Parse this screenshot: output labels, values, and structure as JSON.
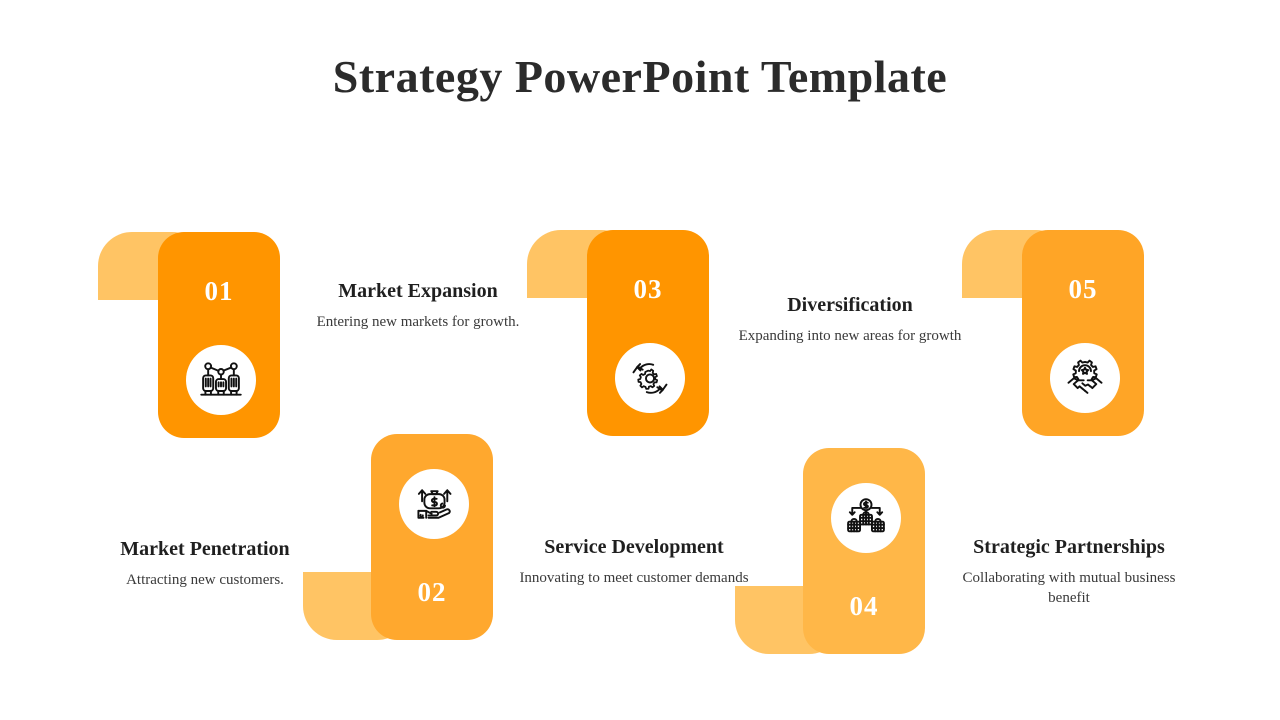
{
  "slide": {
    "title": "Strategy PowerPoint Template",
    "background_color": "#FFFFFF",
    "title_color": "#2B2B2B"
  },
  "palette": {
    "shadow_orange": "#FFC464",
    "orange_1": "#FF9500",
    "orange_2": "#FFA82E",
    "orange_3": "#FF9500",
    "orange_4": "#FFB748",
    "orange_5": "#FFA526",
    "number_color": "#FFFFFF",
    "icon_color": "#111111"
  },
  "steps": [
    {
      "number": "01",
      "title": "Market Penetration",
      "description": "Attracting new customers.",
      "icon": "market-penetration-icon",
      "orientation": "up",
      "card_color": "#FF9500"
    },
    {
      "number": "02",
      "title": "Market Expansion",
      "description": "Entering new markets for growth.",
      "icon": "hand-money-growth-icon",
      "orientation": "down",
      "card_color": "#FFA82E"
    },
    {
      "number": "03",
      "title": "Service Development",
      "description": "Innovating to meet customer demands",
      "icon": "gear-in-hands-icon",
      "orientation": "up",
      "card_color": "#FF9500"
    },
    {
      "number": "04",
      "title": "Diversification",
      "description": "Expanding into new areas for growth",
      "icon": "money-into-baskets-icon",
      "orientation": "down",
      "card_color": "#FFB748"
    },
    {
      "number": "05",
      "title": "Strategic Partnerships",
      "description": "Collaborating with mutual business benefit",
      "icon": "handshake-gear-icon",
      "orientation": "up",
      "card_color": "#FFA526"
    }
  ]
}
